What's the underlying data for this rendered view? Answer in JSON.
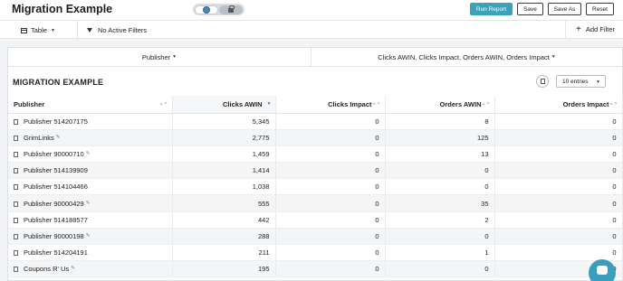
{
  "header": {
    "title": "Migration Example",
    "buttons": {
      "run_report": "Run Report",
      "save": "Save",
      "save_as": "Save As",
      "reset": "Reset"
    }
  },
  "toolbar": {
    "view_label": "Table",
    "filter_label": "No Active Filters",
    "add_filter_label": "Add Filter"
  },
  "pivot": {
    "rows_label": "Publisher",
    "metrics_label": "Clicks AWIN, Clicks Impact, Orders AWIN, Orders Impact"
  },
  "report": {
    "title": "MIGRATION EXAMPLE",
    "entries_select": "10 entries"
  },
  "table": {
    "columns": [
      "Publisher",
      "Clicks AWIN",
      "Clicks Impact",
      "Orders AWIN",
      "Orders Impact"
    ],
    "rows": [
      {
        "publisher": "Publisher 514207175",
        "clicks_awin": "5,345",
        "clicks_impact": "0",
        "orders_awin": "8",
        "orders_impact": "0"
      },
      {
        "publisher": "GrimLinks",
        "clicks_awin": "2,775",
        "clicks_impact": "0",
        "orders_awin": "125",
        "orders_impact": "0"
      },
      {
        "publisher": "Publisher 90000710",
        "clicks_awin": "1,459",
        "clicks_impact": "0",
        "orders_awin": "13",
        "orders_impact": "0"
      },
      {
        "publisher": "Publisher 514139909",
        "clicks_awin": "1,414",
        "clicks_impact": "0",
        "orders_awin": "0",
        "orders_impact": "0"
      },
      {
        "publisher": "Publisher 514104466",
        "clicks_awin": "1,038",
        "clicks_impact": "0",
        "orders_awin": "0",
        "orders_impact": "0"
      },
      {
        "publisher": "Publisher 90000429",
        "clicks_awin": "555",
        "clicks_impact": "0",
        "orders_awin": "35",
        "orders_impact": "0"
      },
      {
        "publisher": "Publisher 514188577",
        "clicks_awin": "442",
        "clicks_impact": "0",
        "orders_awin": "2",
        "orders_impact": "0"
      },
      {
        "publisher": "Publisher 90000198",
        "clicks_awin": "288",
        "clicks_impact": "0",
        "orders_awin": "0",
        "orders_impact": "0"
      },
      {
        "publisher": "Publisher 514204191",
        "clicks_awin": "211",
        "clicks_impact": "0",
        "orders_awin": "1",
        "orders_impact": "0"
      },
      {
        "publisher": "Coupons R' Us",
        "clicks_awin": "195",
        "clicks_impact": "0",
        "orders_awin": "0",
        "orders_impact": "0"
      }
    ]
  },
  "icons": {
    "globe": "globe-icon",
    "lock": "lock-icon",
    "table": "table-icon",
    "funnel": "filter-icon",
    "plus": "plus-icon",
    "export": "export-icon",
    "row_doc": "document-icon",
    "edit": "edit-icon",
    "chat": "chat-icon"
  },
  "colors": {
    "primary": "#3aa2b9",
    "chat": "#3a9fbf",
    "sort_active": "#5a6fb8"
  }
}
